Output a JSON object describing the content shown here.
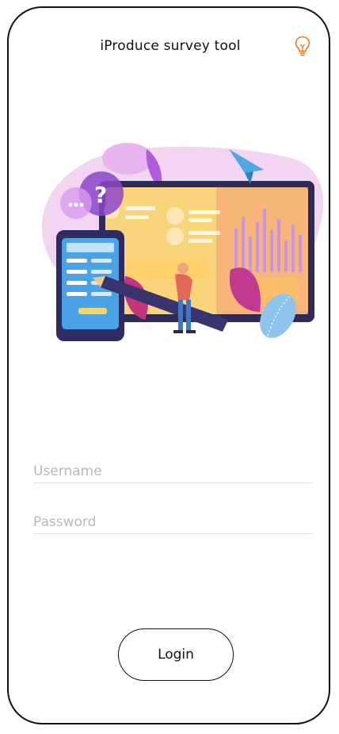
{
  "app": {
    "title": "iProduce survey tool",
    "hint_icon": "lightbulb-icon"
  },
  "hero": {
    "icon": "survey-illustration"
  },
  "form": {
    "username_placeholder": "Username",
    "password_placeholder": "Password",
    "username_value": "",
    "password_value": ""
  },
  "actions": {
    "login_label": "Login"
  },
  "colors": {
    "frame_border": "#111111",
    "bulb_accent": "#f07a1e",
    "placeholder_text": "#b8b8b8",
    "underline": "#e3e3e3"
  }
}
